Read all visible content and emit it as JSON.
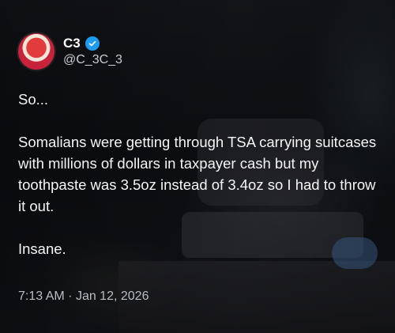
{
  "post": {
    "author_name": "C3",
    "handle": "@C_3C_3",
    "paragraphs": [
      "So...",
      "Somalians were getting through TSA carrying suitcases with millions of dollars in taxpayer cash but my toothpaste was 3.5oz instead of 3.4oz so I had to throw it out.",
      "Insane."
    ],
    "time": "7:13 AM",
    "separator": "·",
    "date": "Jan 12, 2026"
  },
  "icons": {
    "verified": "verified-badge-icon"
  },
  "colors": {
    "verified": "#1d9bf0",
    "text": "#f5f5f5",
    "muted": "#b9bcc2"
  }
}
